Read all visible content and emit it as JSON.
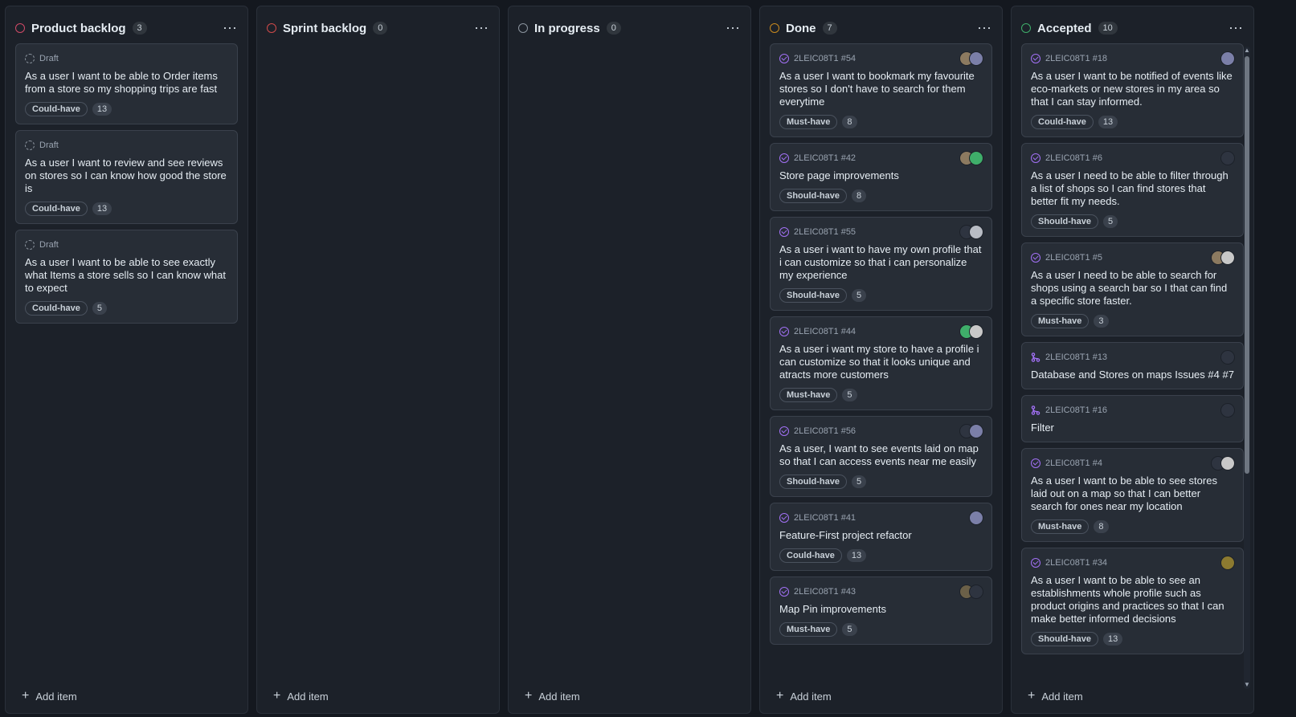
{
  "columns": [
    {
      "title": "Product backlog",
      "count": "3",
      "dot_color": "#d04a67",
      "cards": [
        {
          "type": "draft",
          "meta": "Draft",
          "title": "As a user I want to be able to Order items from a store so my shopping trips are fast",
          "label": "Could-have",
          "estimate": "13",
          "avatars": []
        },
        {
          "type": "draft",
          "meta": "Draft",
          "title": "As a user I want to review and see reviews on stores so I can know how good the store is",
          "label": "Could-have",
          "estimate": "13",
          "avatars": []
        },
        {
          "type": "draft",
          "meta": "Draft",
          "title": "As a user I want to be able to see exactly what Items a store sells so I can know what to expect",
          "label": "Could-have",
          "estimate": "5",
          "avatars": []
        }
      ],
      "add_label": "Add item"
    },
    {
      "title": "Sprint backlog",
      "count": "0",
      "dot_color": "#d04a4a",
      "cards": [],
      "add_label": "Add item"
    },
    {
      "title": "In progress",
      "count": "0",
      "dot_color": "#8b949e",
      "cards": [],
      "add_label": "Add item"
    },
    {
      "title": "Done",
      "count": "7",
      "dot_color": "#c98a1e",
      "cards": [
        {
          "type": "issue",
          "meta": "2LEIC08T1 #54",
          "title": "As a user I want to bookmark my favourite stores so I don't have to search for them everytime",
          "label": "Must-have",
          "estimate": "8",
          "avatars": [
            "#8c7a60",
            "#7b7fa8"
          ]
        },
        {
          "type": "issue",
          "meta": "2LEIC08T1 #42",
          "title": "Store page improvements",
          "label": "Should-have",
          "estimate": "8",
          "avatars": [
            "#8c7a60",
            "#3fae6a"
          ]
        },
        {
          "type": "issue",
          "meta": "2LEIC08T1 #55",
          "title": "As a user i want to have my own profile that i can customize so that i can personalize my experience",
          "label": "Should-have",
          "estimate": "5",
          "avatars": [
            "#2e3440",
            "#b8bcc4"
          ]
        },
        {
          "type": "issue",
          "meta": "2LEIC08T1 #44",
          "title": "As a user i want my store to have a profile i can customize so that it looks unique and atracts more customers",
          "label": "Must-have",
          "estimate": "5",
          "avatars": [
            "#3fae6a",
            "#c8c8c8"
          ]
        },
        {
          "type": "issue",
          "meta": "2LEIC08T1 #56",
          "title": "As a user, I want to see events laid on map so that I can access events near me easily",
          "label": "Should-have",
          "estimate": "5",
          "avatars": [
            "#2e3440",
            "#7b7fa8"
          ]
        },
        {
          "type": "issue",
          "meta": "2LEIC08T1 #41",
          "title": "Feature-First project refactor",
          "label": "Could-have",
          "estimate": "13",
          "avatars": [
            "#7b7fa8"
          ]
        },
        {
          "type": "issue",
          "meta": "2LEIC08T1 #43",
          "title": "Map Pin improvements",
          "label": "Must-have",
          "estimate": "5",
          "avatars": [
            "#6b6048",
            "#2e3440"
          ]
        }
      ],
      "add_label": "Add item"
    },
    {
      "title": "Accepted",
      "count": "10",
      "dot_color": "#3fae6a",
      "cards": [
        {
          "type": "issue",
          "meta": "2LEIC08T1 #18",
          "title": "As a user I want to be notified of events like eco-markets or new stores in my area so that I can stay informed.",
          "label": "Could-have",
          "estimate": "13",
          "avatars": [
            "#7b7fa8"
          ]
        },
        {
          "type": "issue",
          "meta": "2LEIC08T1 #6",
          "title": "As a user I need to be able to filter through a list of shops so I can find stores that better fit my needs.",
          "label": "Should-have",
          "estimate": "5",
          "avatars": [
            "#2e3440"
          ]
        },
        {
          "type": "issue",
          "meta": "2LEIC08T1 #5",
          "title": "As a user I need to be able to search for shops using a search bar so I that can find a specific store faster.",
          "label": "Must-have",
          "estimate": "3",
          "avatars": [
            "#8c7a60",
            "#c8c8c8"
          ]
        },
        {
          "type": "pr",
          "meta": "2LEIC08T1 #13",
          "title": "Database and Stores on maps Issues #4 #7",
          "label": "",
          "estimate": "",
          "avatars": [
            "#2e3440"
          ]
        },
        {
          "type": "pr",
          "meta": "2LEIC08T1 #16",
          "title": "Filter",
          "label": "",
          "estimate": "",
          "avatars": [
            "#2e3440"
          ]
        },
        {
          "type": "issue",
          "meta": "2LEIC08T1 #4",
          "title": "As a user I want to be able to see stores laid out on a map so that I can better search for ones near my location",
          "label": "Must-have",
          "estimate": "8",
          "avatars": [
            "#2e3440",
            "#c8c8c8"
          ]
        },
        {
          "type": "issue",
          "meta": "2LEIC08T1 #34",
          "title": "As a user I want to be able to see an establishments whole profile such as product origins and practices so that I can make better informed decisions",
          "label": "Should-have",
          "estimate": "13",
          "avatars": [
            "#8c7a30"
          ]
        }
      ],
      "add_label": "Add item"
    }
  ],
  "icons": {
    "menu": "more-horizontal-icon",
    "add": "plus-icon",
    "draft": "draft-circle-icon",
    "issue": "issue-closed-icon",
    "pr": "pull-request-merged-icon"
  },
  "colors": {
    "accent_purple": "#a371f7",
    "background": "#14181f"
  }
}
